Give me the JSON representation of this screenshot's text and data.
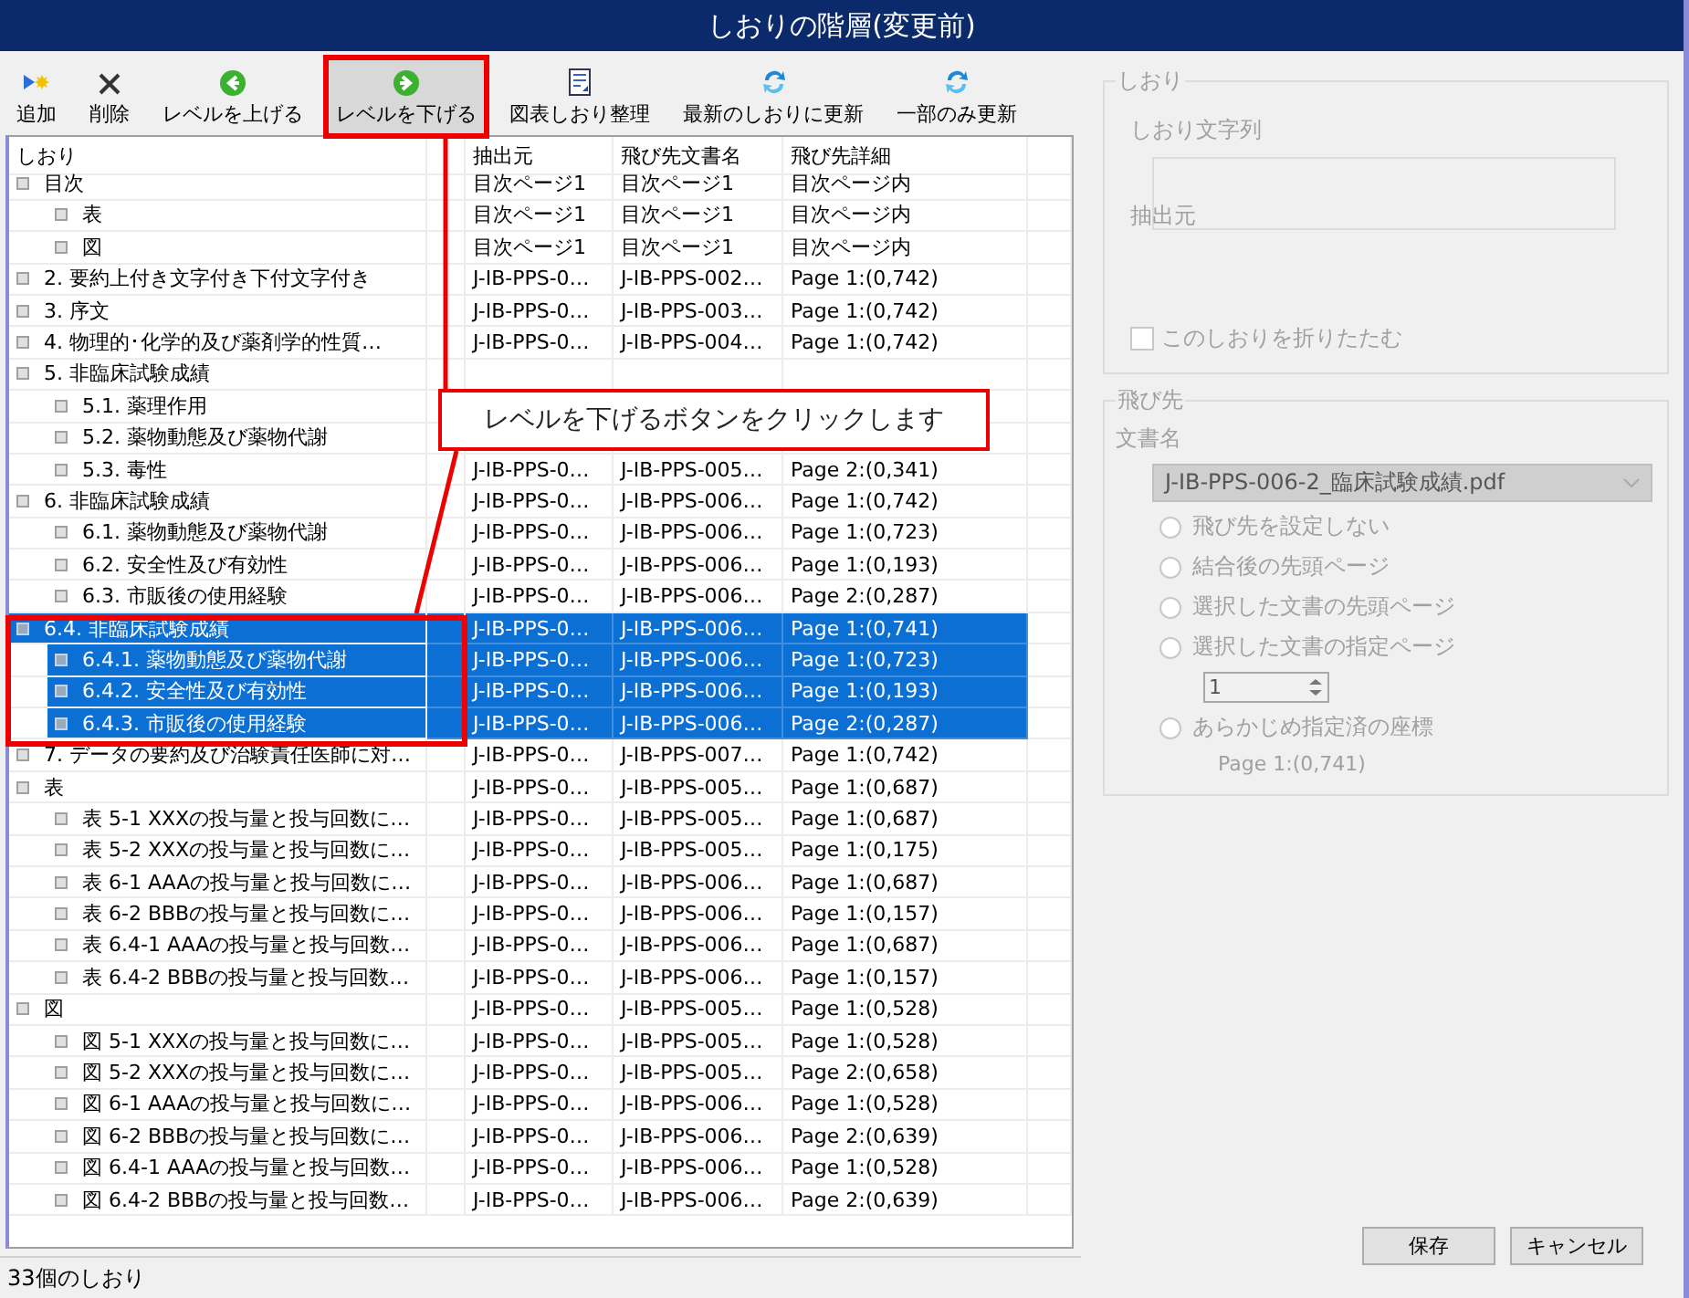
{
  "window": {
    "title": "しおりの階層(変更前)"
  },
  "toolbar": [
    {
      "kind": "add",
      "label": "追加",
      "pressed": false,
      "highlighted": false
    },
    {
      "kind": "delete",
      "label": "削除",
      "pressed": false,
      "highlighted": false
    },
    {
      "kind": "up",
      "label": "レベルを上げる",
      "pressed": false,
      "highlighted": false
    },
    {
      "kind": "down",
      "label": "レベルを下げる",
      "pressed": true,
      "highlighted": true
    },
    {
      "kind": "organize",
      "label": "図表しおり整理",
      "pressed": false,
      "highlighted": false
    },
    {
      "kind": "refresh",
      "label": "最新のしおりに更新",
      "pressed": false,
      "highlighted": false
    },
    {
      "kind": "refresh",
      "label": "一部のみ更新",
      "pressed": false,
      "highlighted": false
    }
  ],
  "table": {
    "columns": [
      "しおり",
      "抽出元",
      "飛び先文書名",
      "飛び先詳細"
    ],
    "rows": [
      {
        "label": "目次",
        "source": "目次ページ1",
        "doc": "目次ページ1",
        "detail": "目次ページ内",
        "selected": false,
        "children": [
          {
            "label": "表",
            "source": "目次ページ1",
            "doc": "目次ページ1",
            "detail": "目次ページ内",
            "selected": false
          },
          {
            "label": "図",
            "source": "目次ページ1",
            "doc": "目次ページ1",
            "detail": "目次ページ内",
            "selected": false
          }
        ]
      },
      {
        "label": "2. 要約上付き文字付き下付文字付き",
        "source": "J-IB-PPS-0…",
        "doc": "J-IB-PPS-002…",
        "detail": "Page 1:(0,742)",
        "selected": false
      },
      {
        "label": "3. 序文",
        "source": "J-IB-PPS-0…",
        "doc": "J-IB-PPS-003…",
        "detail": "Page 1:(0,742)",
        "selected": false
      },
      {
        "label": "4. 物理的･化学的及び薬剤学的性質…",
        "source": "J-IB-PPS-0…",
        "doc": "J-IB-PPS-004…",
        "detail": "Page 1:(0,742)",
        "selected": false
      },
      {
        "label": "5. 非臨床試験成績",
        "selected": false,
        "children": [
          {
            "label": "5.1. 薬理作用",
            "selected": false
          },
          {
            "label": "5.2. 薬物動態及び薬物代謝",
            "selected": false
          },
          {
            "label": "5.3. 毒性",
            "source": "J-IB-PPS-0…",
            "doc": "J-IB-PPS-005…",
            "detail": "Page 2:(0,341)",
            "selected": false
          }
        ]
      },
      {
        "label": "6. 非臨床試験成績",
        "source": "J-IB-PPS-0…",
        "doc": "J-IB-PPS-006…",
        "detail": "Page 1:(0,742)",
        "selected": false,
        "children": [
          {
            "label": "6.1. 薬物動態及び薬物代謝",
            "source": "J-IB-PPS-0…",
            "doc": "J-IB-PPS-006…",
            "detail": "Page 1:(0,723)",
            "selected": false
          },
          {
            "label": "6.2. 安全性及び有効性",
            "source": "J-IB-PPS-0…",
            "doc": "J-IB-PPS-006…",
            "detail": "Page 1:(0,193)",
            "selected": false
          },
          {
            "label": "6.3. 市販後の使用経験",
            "source": "J-IB-PPS-0…",
            "doc": "J-IB-PPS-006…",
            "detail": "Page 2:(0,287)",
            "selected": false
          }
        ]
      },
      {
        "label": "6.4. 非臨床試験成績",
        "source": "J-IB-PPS-0…",
        "doc": "J-IB-PPS-006…",
        "detail": "Page 1:(0,741)",
        "selected": true,
        "children": [
          {
            "label": "6.4.1. 薬物動態及び薬物代謝",
            "source": "J-IB-PPS-0…",
            "doc": "J-IB-PPS-006…",
            "detail": "Page 1:(0,723)",
            "selected": true
          },
          {
            "label": "6.4.2. 安全性及び有効性",
            "source": "J-IB-PPS-0…",
            "doc": "J-IB-PPS-006…",
            "detail": "Page 1:(0,193)",
            "selected": true
          },
          {
            "label": "6.4.3. 市販後の使用経験",
            "source": "J-IB-PPS-0…",
            "doc": "J-IB-PPS-006…",
            "detail": "Page 2:(0,287)",
            "selected": true
          }
        ]
      },
      {
        "label": "7. データの要約及び治験責任医師に対…",
        "source": "J-IB-PPS-0…",
        "doc": "J-IB-PPS-007…",
        "detail": "Page 1:(0,742)",
        "selected": false
      },
      {
        "label": "表",
        "source": "J-IB-PPS-0…",
        "doc": "J-IB-PPS-005…",
        "detail": "Page 1:(0,687)",
        "selected": false,
        "children": [
          {
            "label": "表 5-1 XXXの投与量と投与回数に…",
            "source": "J-IB-PPS-0…",
            "doc": "J-IB-PPS-005…",
            "detail": "Page 1:(0,687)",
            "selected": false
          },
          {
            "label": "表 5-2 XXXの投与量と投与回数に…",
            "source": "J-IB-PPS-0…",
            "doc": "J-IB-PPS-005…",
            "detail": "Page 1:(0,175)",
            "selected": false
          },
          {
            "label": "表 6-1 AAAの投与量と投与回数に…",
            "source": "J-IB-PPS-0…",
            "doc": "J-IB-PPS-006…",
            "detail": "Page 1:(0,687)",
            "selected": false
          },
          {
            "label": "表 6-2 BBBの投与量と投与回数に…",
            "source": "J-IB-PPS-0…",
            "doc": "J-IB-PPS-006…",
            "detail": "Page 1:(0,157)",
            "selected": false
          },
          {
            "label": "表 6.4-1 AAAの投与量と投与回数…",
            "source": "J-IB-PPS-0…",
            "doc": "J-IB-PPS-006…",
            "detail": "Page 1:(0,687)",
            "selected": false
          },
          {
            "label": "表 6.4-2 BBBの投与量と投与回数…",
            "source": "J-IB-PPS-0…",
            "doc": "J-IB-PPS-006…",
            "detail": "Page 1:(0,157)",
            "selected": false
          }
        ]
      },
      {
        "label": "図",
        "source": "J-IB-PPS-0…",
        "doc": "J-IB-PPS-005…",
        "detail": "Page 1:(0,528)",
        "selected": false,
        "children": [
          {
            "label": "図 5-1 XXXの投与量と投与回数に…",
            "source": "J-IB-PPS-0…",
            "doc": "J-IB-PPS-005…",
            "detail": "Page 1:(0,528)",
            "selected": false
          },
          {
            "label": "図 5-2 XXXの投与量と投与回数に…",
            "source": "J-IB-PPS-0…",
            "doc": "J-IB-PPS-005…",
            "detail": "Page 2:(0,658)",
            "selected": false
          },
          {
            "label": "図 6-1 AAAの投与量と投与回数に…",
            "source": "J-IB-PPS-0…",
            "doc": "J-IB-PPS-006…",
            "detail": "Page 1:(0,528)",
            "selected": false
          },
          {
            "label": "図 6-2 BBBの投与量と投与回数に…",
            "source": "J-IB-PPS-0…",
            "doc": "J-IB-PPS-006…",
            "detail": "Page 2:(0,639)",
            "selected": false
          },
          {
            "label": "図 6.4-1 AAAの投与量と投与回数…",
            "source": "J-IB-PPS-0…",
            "doc": "J-IB-PPS-006…",
            "detail": "Page 1:(0,528)",
            "selected": false
          },
          {
            "label": "図 6.4-2 BBBの投与量と投与回数…",
            "source": "J-IB-PPS-0…",
            "doc": "J-IB-PPS-006…",
            "detail": "Page 2:(0,639)",
            "selected": false
          }
        ]
      }
    ]
  },
  "status_bar": "33個のしおり",
  "bookmark_group": {
    "title": "しおり",
    "text_label": "しおり文字列",
    "source_label": "抽出元",
    "collapse": {
      "label": "このしおりを折りたたむ",
      "checked": false,
      "disabled": true
    }
  },
  "target_group": {
    "title": "飛び先",
    "doc_label": "文書名",
    "doc_value": "J-IB-PPS-006-2_臨床試験成績.pdf",
    "options": [
      {
        "label": "飛び先を設定しない",
        "selected": false
      },
      {
        "label": "結合後の先頭ページ",
        "selected": false
      },
      {
        "label": "選択した文書の先頭ページ",
        "selected": false
      },
      {
        "label": "選択した文書の指定ページ",
        "selected": false
      },
      {
        "label": "あらかじめ指定済の座標",
        "selected": false
      }
    ],
    "page_value": "1",
    "coordinate": "Page 1:(0,741)",
    "disabled": true
  },
  "buttons": [
    "保存",
    "キャンセル"
  ],
  "annotation": {
    "callout": "レベルを下げるボタンをクリックします"
  }
}
